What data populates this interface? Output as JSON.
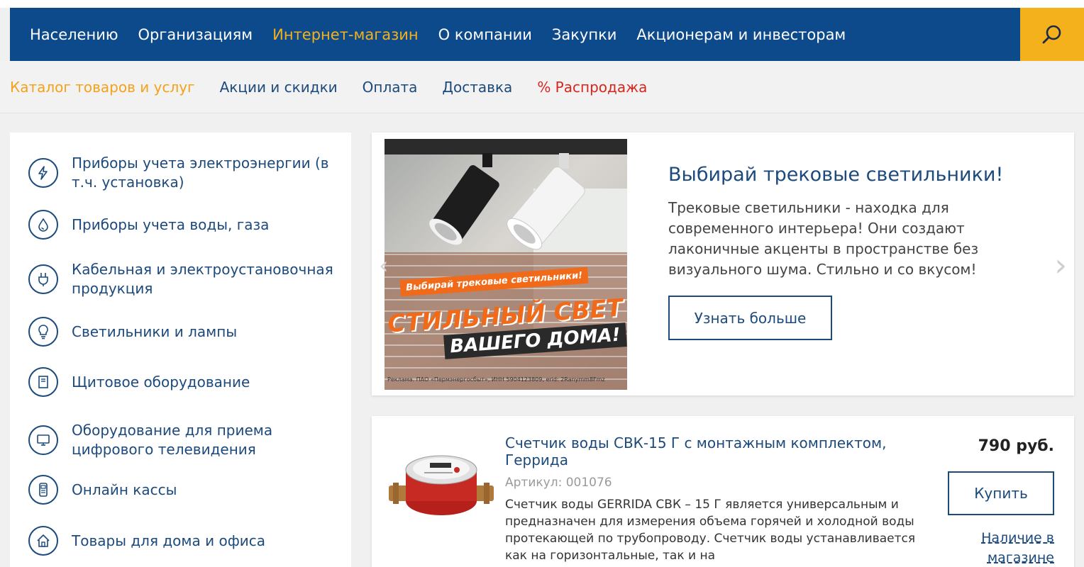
{
  "top_nav": {
    "items": [
      {
        "label": "Населению"
      },
      {
        "label": "Организациям"
      },
      {
        "label": "Интернет-магазин"
      },
      {
        "label": "О компании"
      },
      {
        "label": "Закупки"
      },
      {
        "label": "Акционерам и инвесторам"
      }
    ],
    "active_index": 2,
    "search_icon": "search-icon"
  },
  "sub_nav": {
    "items": [
      {
        "label": "Каталог товаров и услуг"
      },
      {
        "label": "Акции и скидки"
      },
      {
        "label": "Оплата"
      },
      {
        "label": "Доставка"
      },
      {
        "label": "% Распродажа"
      }
    ]
  },
  "sidebar": {
    "categories": [
      {
        "label": "Приборы учета электроэнергии (в т.ч. установка)",
        "icon": "lightning-icon"
      },
      {
        "label": "Приборы учета воды, газа",
        "icon": "drop-icon"
      },
      {
        "label": "Кабельная и электроустановочная продукция",
        "icon": "plug-icon"
      },
      {
        "label": "Светильники и лампы",
        "icon": "bulb-icon"
      },
      {
        "label": "Щитовое оборудование",
        "icon": "panel-icon"
      },
      {
        "label": "Оборудование для приема цифрового телевидения",
        "icon": "tv-icon"
      },
      {
        "label": "Онлайн кассы",
        "icon": "cash-register-icon"
      },
      {
        "label": "Товары для дома и офиса",
        "icon": "house-icon"
      }
    ]
  },
  "banner": {
    "promo_strip": "Выбирай трековые светильники!",
    "promo_headline_1": "СТИЛЬНЫЙ СВЕТ",
    "promo_headline_2": "ВАШЕГО ДОМА!",
    "promo_fine_print": "Реклама. ПАО «Пермэнергосбыт», ИНН 5904123809, erid: 2Ranymm8Fmz",
    "title": "Выбирай трековые светильники!",
    "description": "Трековые светильники - находка для современного интерьера! Они создают лаконичные акценты в пространстве без визуального шума. Стильно и со вкусом!",
    "button_label": "Узнать больше",
    "prev_arrow": "‹",
    "next_arrow": "›"
  },
  "product": {
    "title": "Счетчик воды СВК-15 Г с монтажным комплектом, Геррида",
    "sku": "Артикул: 001076",
    "description": "Счетчик воды GERRIDA СВК – 15 Г является универсальным и предназначен для измерения объема горячей и холодной воды протекающей по трубопроводу. Счетчик воды устанавливается как на горизонтальные, так и на",
    "price": "790 руб.",
    "buy_label": "Купить",
    "stock_label": "Наличие в магазине"
  },
  "colors": {
    "brand_blue": "#0d4a8c",
    "accent_yellow": "#f4b11c",
    "sale_red": "#d8261c",
    "link_blue": "#1c4a7c"
  }
}
